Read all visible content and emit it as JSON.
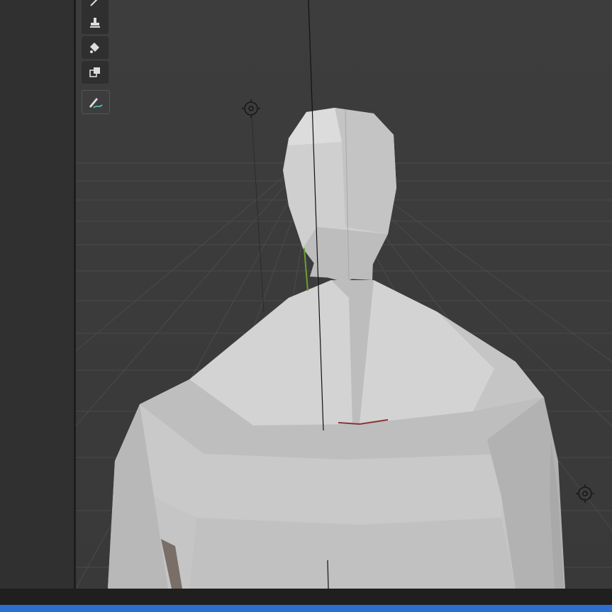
{
  "app": {
    "name": "3D viewport"
  },
  "toolbar": {
    "tools": [
      {
        "name": "annotate-top-partial-icon"
      },
      {
        "name": "stamp-icon"
      },
      {
        "name": "paint-bucket-icon"
      },
      {
        "name": "clone-layers-icon"
      },
      {
        "name": "draw-curve-icon"
      }
    ]
  },
  "viewport": {
    "objects": [
      "character-mesh",
      "light-gizmo-left",
      "light-gizmo-right",
      "grid-floor"
    ]
  },
  "colors": {
    "viewport_bg": "#3a3a3a",
    "panel_bg": "#303030",
    "taskbar": "#2d6fd1",
    "mesh": "#c8c8c8"
  }
}
